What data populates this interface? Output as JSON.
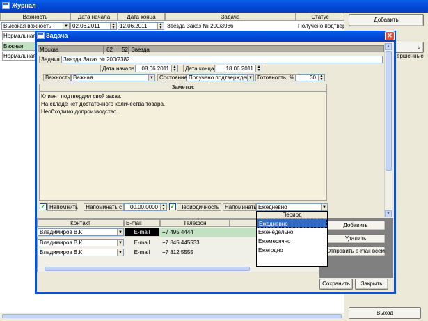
{
  "main_window": {
    "title": "Журнал",
    "columns": [
      "Важность",
      "Дата начала",
      "Дата конца",
      "Задача",
      "Статус"
    ],
    "rows": [
      {
        "importance": "Высокая важность",
        "start": "02.06.2011",
        "end": "12.06.2011",
        "task": "Звезда Заказ № 200/3986",
        "status": "Получено подтвер"
      },
      {
        "importance": "Нормальная",
        "start": "",
        "end": "",
        "task": "",
        "status": ""
      },
      {
        "importance": "Важная",
        "start": "",
        "end": "",
        "task": "",
        "status": ""
      },
      {
        "importance": "Нормальная",
        "start": "",
        "end": "",
        "task": "",
        "status": ""
      }
    ],
    "add_button": "Добавить",
    "partial_button_text": "ь",
    "partial_status_text": "ершенные",
    "exit_button": "Выход"
  },
  "dialog": {
    "title": "Задача",
    "info_bar": {
      "city": "Москва",
      "num1": "62",
      "num2": "52",
      "name": "Звезда"
    },
    "task_label": "Задача",
    "task_value": "Звезда Заказ № 200/2382",
    "start_label": "Дата начала",
    "start_value": "08.06.2011",
    "end_label": "Дата конца",
    "end_value": "18.06.2011",
    "importance_label": "Важность",
    "importance_value": "Важная",
    "state_label": "Состояние",
    "state_value": "Получено подтвержден",
    "readiness_label": "Готовность, %",
    "readiness_value": "30",
    "notes_header": "Заметки:",
    "notes": [
      "Клиент подтвердил свой заказ.",
      "На складе нет достаточного количества товара.",
      "Необходимо допроизводство."
    ],
    "remind_label": "Напомнить",
    "remind_from_label": "Напоминать с",
    "remind_from_value": "00.00.0000",
    "periodic_label": "Периодичность",
    "remind_period_label": "Напоминать",
    "remind_period_value": "Ежедневно",
    "contacts_columns": [
      "Контакт",
      "E-mail",
      "Телефон"
    ],
    "contacts": [
      {
        "name": "Владимиров В.К",
        "email": "E-mail",
        "phone": "+7 495 4444"
      },
      {
        "name": "Владимиров В.К",
        "email": "E-mail",
        "phone": "+7 845 445533"
      },
      {
        "name": "Владимиров В.К",
        "email": "E-mail",
        "phone": "+7 812 5555"
      }
    ],
    "period_dropdown": {
      "header": "Период",
      "options": [
        "Ежедневно",
        "Еженедельно",
        "Ежемесячно",
        "Ежегодно"
      ],
      "selected_index": 0
    },
    "buttons": {
      "add": "Добавить",
      "delete": "Удалить",
      "send_email": "Отправить e-mail всем",
      "save": "Сохранить",
      "close": "Закрыть"
    }
  },
  "colors": {
    "title_blue": "#0046d5",
    "selected_row": "#c2e0c2",
    "dropdown_highlight": "#316ac5",
    "notes_bg": "#f5f0dc"
  }
}
